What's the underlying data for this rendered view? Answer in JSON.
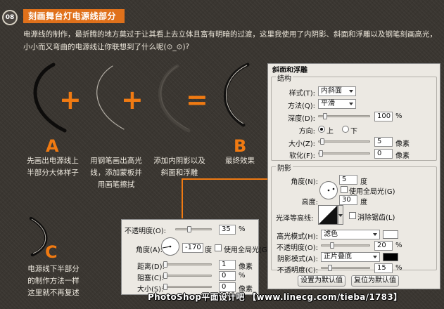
{
  "header": {
    "step_number": "08",
    "title": "刻画舞台灯电源线部分"
  },
  "intro": "电源线的制作，最折腾的地方莫过于让其看上去立体且富有明暗的过渡，这里我使用了内阴影、斜面和浮雕以及钢笔刻画高光，小小而又弯曲的电源线让你联想到了什么呢(⊙_⊙)?",
  "figure": {
    "plus1": "+",
    "plus2": "+",
    "equals": "=",
    "letter_a": "A",
    "letter_b": "B",
    "letter_c": "C",
    "caption1": [
      "先画出电源线上",
      "半部分大体样子"
    ],
    "caption2": [
      "用钢笔画出高光",
      "线，添加蒙板并",
      "用画笔擦拭"
    ],
    "caption3": [
      "添加内阴影以及",
      "斜面和浮雕"
    ],
    "caption4": [
      "最终效果"
    ],
    "caption5": [
      "电源线下半部分",
      "的制作方法一样",
      "这里就不再复述"
    ]
  },
  "shadow_panel": {
    "opacity_label": "不透明度(O):",
    "opacity_value": "35",
    "opacity_unit": "%",
    "opacity_level": 0.35,
    "angle_label": "角度(A):",
    "angle_value": "-170",
    "angle_unit": "度",
    "global_light_label": "使用全局光(G)",
    "distance_label": "距离(D):",
    "distance_value": "1",
    "distance_unit": "像素",
    "choke_label": "阻塞(C):",
    "choke_value": "0",
    "choke_unit": "%",
    "size_label": "大小(S):",
    "size_value": "0",
    "size_unit": "像素"
  },
  "bevel_panel": {
    "title": "斜面和浮雕",
    "structure_legend": "结构",
    "style_label": "样式(T):",
    "style_value": "内斜面",
    "technique_label": "方法(Q):",
    "technique_value": "平滑",
    "depth_label": "深度(D):",
    "depth_value": "100",
    "depth_unit": "%",
    "direction_label": "方向:",
    "direction_up": "上",
    "direction_down": "下",
    "size_label": "大小(Z):",
    "size_value": "5",
    "size_unit": "像素",
    "soften_label": "软化(F):",
    "soften_value": "0",
    "soften_unit": "像素",
    "shading_legend": "阴影",
    "angle_label": "角度(N):",
    "angle_value": "5",
    "angle_unit": "度",
    "global_light_label": "使用全局光(G)",
    "altitude_label": "高度:",
    "altitude_value": "30",
    "altitude_unit": "度",
    "gloss_label": "光泽等高线:",
    "antialias_label": "消除锯齿(L)",
    "highlight_mode_label": "高光模式(H):",
    "highlight_mode_value": "滤色",
    "highlight_color": "#ffffff",
    "highlight_opacity_label": "不透明度(O):",
    "highlight_opacity_value": "20",
    "highlight_opacity_unit": "%",
    "shadow_mode_label": "阴影模式(A):",
    "shadow_mode_value": "正片叠底",
    "shadow_color": "#000000",
    "shadow_opacity_label": "不透明度(C):",
    "shadow_opacity_value": "15",
    "shadow_opacity_unit": "%",
    "default_button": "设置为默认值",
    "reset_button": "复位为默认值"
  },
  "watermark": "PhotoShop平面设计吧  【www.linecg.com/tieba/1783】",
  "colors": {
    "accent": "#f07a12",
    "title_bar": "#e0711b",
    "background": "#3a3631",
    "dialog": "#ece9e3"
  }
}
